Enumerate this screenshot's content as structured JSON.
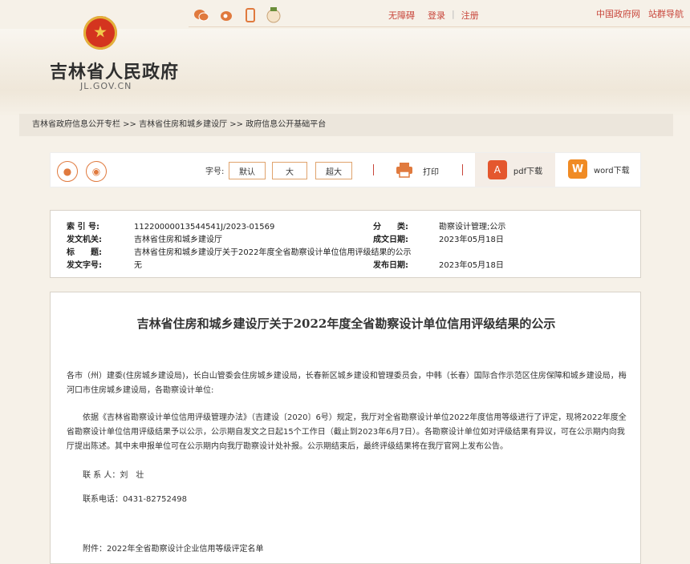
{
  "top_links": {
    "accessibility": "无障碍",
    "login": "登录",
    "register": "注册",
    "gov": "中国政府网",
    "nav": "站群导航"
  },
  "site": {
    "title": "吉林省人民政府",
    "domain": "JL.GOV.CN"
  },
  "breadcrumb": "吉林省政府信息公开专栏 >> 吉林省住房和城乡建设厅 >> 政府信息公开基础平台",
  "toolbar": {
    "font_label": "字号:",
    "font_default": "默认",
    "font_large": "大",
    "font_xlarge": "超大",
    "print": "打印",
    "pdf": "pdf下载",
    "word": "word下载"
  },
  "meta": {
    "index_label": "索 引 号:",
    "index_value": "11220000013544541J/2023-01569",
    "class_label": "分　　类:",
    "class_value": "勘察设计管理;公示",
    "issuer_label": "发文机关:",
    "issuer_value": "吉林省住房和城乡建设厅",
    "date_written_label": "成文日期:",
    "date_written_value": "2023年05月18日",
    "title_label": "标　　题:",
    "title_value": "吉林省住房和城乡建设厅关于2022年度全省勘察设计单位信用评级结果的公示",
    "doc_no_label": "发文字号:",
    "doc_no_value": "无",
    "publish_label": "发布日期:",
    "publish_value": "2023年05月18日"
  },
  "article": {
    "title": "吉林省住房和城乡建设厅关于2022年度全省勘察设计单位信用评级结果的公示",
    "addressees": "各市（州）建委(住房城乡建设局)，长白山管委会住房城乡建设局，长春新区城乡建设和管理委员会，中韩（长春）国际合作示范区住房保障和城乡建设局，梅河口市住房城乡建设局，各勘察设计单位:",
    "body": "依据《吉林省勘察设计单位信用评级管理办法》（吉建设〔2020〕6号）规定，我厅对全省勘察设计单位2022年度信用等级进行了评定，现将2022年度全省勘察设计单位信用评级结果予以公示，公示期自发文之日起15个工作日（截止到2023年6月7日）。各勘察设计单位如对评级结果有异议，可在公示期内向我厅提出陈述。其中未申报单位可在公示期内向我厅勘察设计处补报。公示期结束后，最终评级结果将在我厅官网上发布公告。",
    "contact": "联 系 人：刘　壮",
    "phone": "联系电话：0431-82752498",
    "attachment": "附件：2022年全省勘察设计企业信用等级评定名单"
  },
  "colors": {
    "accent": "#c8453a",
    "orange": "#e07a3e"
  }
}
